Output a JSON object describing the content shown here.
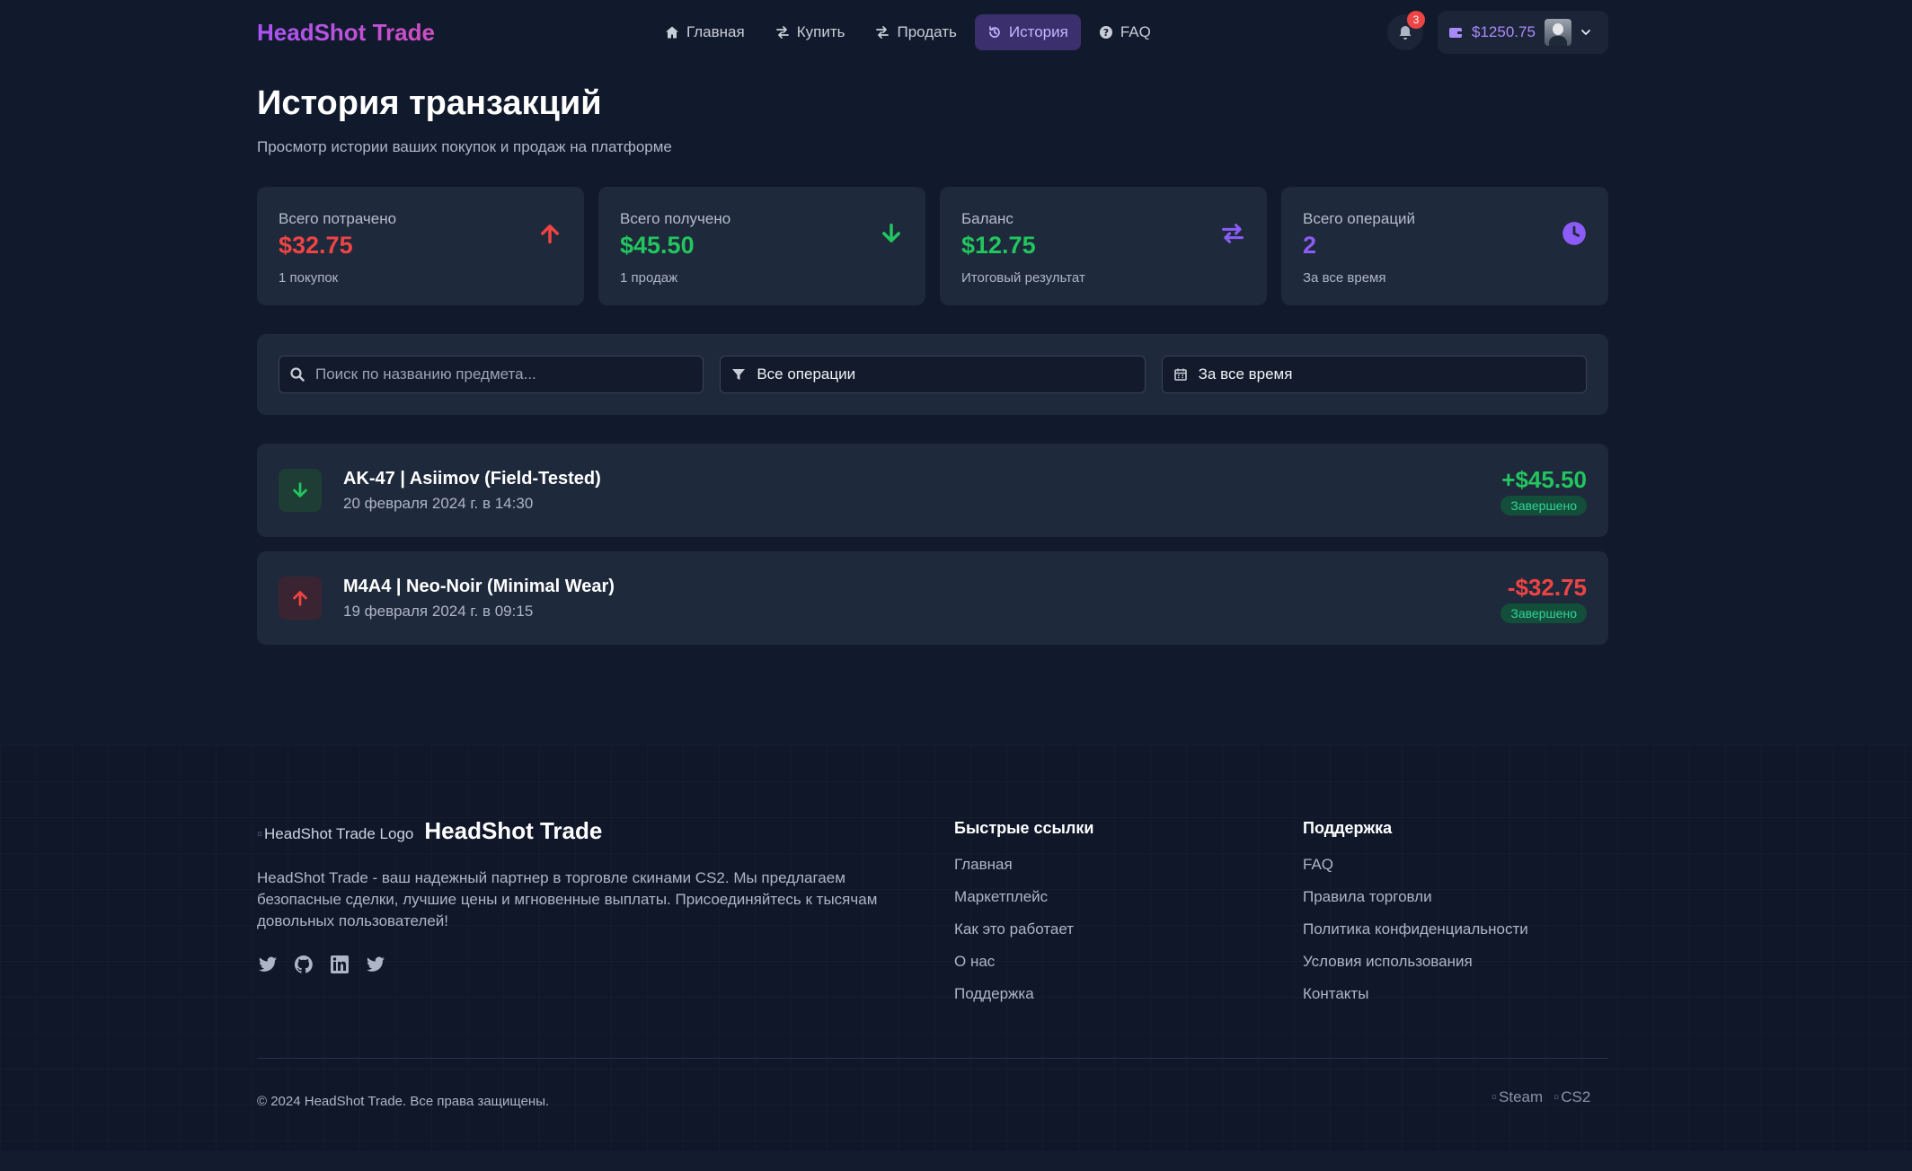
{
  "header": {
    "brand": "HeadShot Trade",
    "nav": [
      {
        "label": "Главная",
        "icon": "home-icon"
      },
      {
        "label": "Купить",
        "icon": "exchange-icon"
      },
      {
        "label": "Продать",
        "icon": "exchange-icon"
      },
      {
        "label": "История",
        "icon": "history-icon",
        "active": true
      },
      {
        "label": "FAQ",
        "icon": "question-circle-icon"
      }
    ],
    "notifications_count": "3",
    "wallet_balance": "$1250.75"
  },
  "page": {
    "title": "История транзакций",
    "subtitle": "Просмотр истории ваших покупок и продаж на платформе"
  },
  "stats": [
    {
      "label": "Всего потрачено",
      "value": "$32.75",
      "sub": "1 покупок",
      "color": "#ef4444",
      "icon": "arrow-up-icon"
    },
    {
      "label": "Всего получено",
      "value": "$45.50",
      "sub": "1 продаж",
      "color": "#22c55e",
      "icon": "arrow-down-icon"
    },
    {
      "label": "Баланс",
      "value": "$12.75",
      "sub": "Итоговый результат",
      "color": "#22c55e",
      "icon": "exchange-icon"
    },
    {
      "label": "Всего операций",
      "value": "2",
      "sub": "За все время",
      "color": "#8b5cf6",
      "icon": "clock-icon"
    }
  ],
  "filters": {
    "search_placeholder": "Поиск по названию предмета...",
    "type_value": "Все операции",
    "period_value": "За все время"
  },
  "transactions": [
    {
      "name": "AK-47 | Asiimov (Field-Tested)",
      "date": "20 февраля 2024 г. в 14:30",
      "amount": "+$45.50",
      "status": "Завершено",
      "direction": "sale"
    },
    {
      "name": "M4A4 | Neo-Noir (Minimal Wear)",
      "date": "19 февраля 2024 г. в 09:15",
      "amount": "-$32.75",
      "status": "Завершено",
      "direction": "purchase"
    }
  ],
  "footer": {
    "logo_alt": "HeadShot Trade Logo",
    "brand": "HeadShot Trade",
    "description": "HeadShot Trade - ваш надежный партнер в торговле скинами CS2. Мы предлагаем безопасные сделки, лучшие цены и мгновенные выплаты. Присоединяйтесь к тысячам довольных пользователей!",
    "social": [
      "twitter-icon",
      "github-icon",
      "linkedin-icon",
      "twitter-icon"
    ],
    "quick_links_title": "Быстрые ссылки",
    "quick_links": [
      "Главная",
      "Маркетплейс",
      "Как это работает",
      "О нас",
      "Поддержка"
    ],
    "support_title": "Поддержка",
    "support_links": [
      "FAQ",
      "Правила торговли",
      "Политика конфиденциальности",
      "Условия использования",
      "Контакты"
    ],
    "copyright": "© 2024 HeadShot Trade. Все права защищены.",
    "partners": [
      "Steam",
      "CS2"
    ]
  },
  "colors": {
    "background": "#111a2c",
    "card": "#1e293b",
    "accent": "#8b5cf6",
    "positive": "#22c55e",
    "negative": "#ef4444"
  }
}
